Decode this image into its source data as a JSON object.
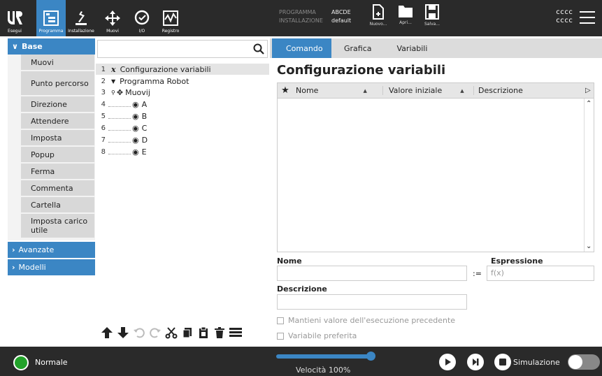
{
  "topbar": {
    "buttons": [
      {
        "label": "Esegui",
        "icon": "ur-logo-icon"
      },
      {
        "label": "Programma",
        "icon": "program-icon"
      },
      {
        "label": "Installazione",
        "icon": "installation-icon"
      },
      {
        "label": "Muovi",
        "icon": "move-icon"
      },
      {
        "label": "I/O",
        "icon": "io-icon"
      },
      {
        "label": "Registro",
        "icon": "log-icon"
      }
    ],
    "program_key": "PROGRAMMA",
    "program_value": "ABCDE",
    "installation_key": "INSTALLAZIONE",
    "installation_value": "default",
    "file_buttons": [
      {
        "label": "Nuovo...",
        "icon": "new-file-icon"
      },
      {
        "label": "Apri...",
        "icon": "folder-icon"
      },
      {
        "label": "Salva...",
        "icon": "save-icon"
      }
    ],
    "robot_line1": "cccc",
    "robot_line2": "cccc"
  },
  "leftnav": {
    "base_label": "Base",
    "items": [
      "Muovi",
      "Punto percorso",
      "Direzione",
      "Attendere",
      "Imposta",
      "Popup",
      "Ferma",
      "Commenta",
      "Cartella",
      "Imposta carico utile"
    ],
    "avanzate_label": "Avanzate",
    "modelli_label": "Modelli"
  },
  "tree": {
    "search_placeholder": "",
    "rows": [
      {
        "num": "1",
        "text": "Configurazione variabili"
      },
      {
        "num": "2",
        "text": "Programma Robot"
      },
      {
        "num": "3",
        "text": "Muovij"
      },
      {
        "num": "4",
        "text": "A"
      },
      {
        "num": "5",
        "text": "B"
      },
      {
        "num": "6",
        "text": "C"
      },
      {
        "num": "7",
        "text": "D"
      },
      {
        "num": "8",
        "text": "E"
      }
    ]
  },
  "right": {
    "tabs": [
      "Comando",
      "Grafica",
      "Variabili"
    ],
    "title": "Configurazione variabili",
    "columns": [
      "Nome",
      "Valore iniziale",
      "Descrizione"
    ],
    "name_label": "Nome",
    "expr_label": "Espressione",
    "assign_symbol": ":=",
    "expr_placeholder": "f(x)",
    "desc_label": "Descrizione",
    "keep_value_label": "Mantieni valore dell'esecuzione precedente",
    "favorite_label": "Variabile preferita"
  },
  "bottombar": {
    "status": "Normale",
    "speed_text": "Velocità 100%",
    "speed_fraction": 1.0,
    "sim_label": "Simulazione"
  },
  "colors": {
    "accent": "#3b86c4",
    "topbar_bg": "#2a2a2a",
    "status_ok": "#22a22a"
  }
}
